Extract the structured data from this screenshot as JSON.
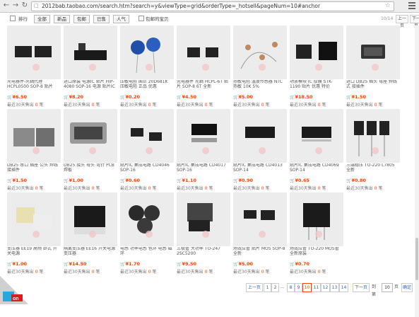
{
  "browser": {
    "url": "2012bab.taobao.com/search.htm?search=y&viewType=grid&orderType=_hotsell&pageNum=10#anchor",
    "star_glyph": "☆"
  },
  "toolbar": {
    "sort_label": "排行",
    "filter_items": [
      "全部",
      "新品",
      "包邮",
      "已售",
      "人气"
    ],
    "free_ship_label": "包邮的宝贝",
    "page_indicator": "10/14",
    "prev_label": "上一页",
    "next_label": "下一页"
  },
  "products": [
    {
      "title": "光电器件-光耦代理 HCPL0500 SOP-8 贴片",
      "price": "6.50",
      "sold": "0"
    },
    {
      "title": "进口原装 电源IC 贴片 HIP-4080 SOP-16 电源 贴片IC",
      "price": "8.20",
      "sold": "0"
    },
    {
      "title": "压敏电阻 国巨 20D681K 压敏电阻 正品 优惠",
      "price": "0.20",
      "price_marker": "",
      "sold": "0"
    },
    {
      "title": "光电器件 光耦 HCPL-6T 贴片 SOP-8 6T 全新",
      "price": "4.50",
      "sold": "0"
    },
    {
      "title": "热敏电阻 温度传感器 NTC 热敏 10K 5%",
      "price": "5.00",
      "sold": "0"
    },
    {
      "title": "功放模块 IC 厚膜 STK-1190 贴片 优惠 特价",
      "price": "18.50",
      "sold": "0"
    },
    {
      "title": "进口 DB25 插头 母座 焊线式 接插件",
      "price": "1.50",
      "sold": "0"
    },
    {
      "title": "DB25 串口 插座 公头 焊线 接插件",
      "price": "1.50",
      "sold": "0"
    },
    {
      "title": "DB25 接头 母头 弯针 PCB 焊板",
      "price": "1.00",
      "sold": "0"
    },
    {
      "title": "贴片IC 集成电路 CD4046 SOP-16",
      "price": "0.60",
      "sold": "0"
    },
    {
      "title": "贴片IC 集成电路 CD4017 SOP-16",
      "price": "1.10",
      "sold": "0"
    },
    {
      "title": "贴片IC 集成电路 CD4013 SOP-14",
      "price": "0.90",
      "sold": "0"
    },
    {
      "title": "贴片IC 集成电路 CD4069 SOP-14",
      "price": "0.65",
      "sold": "0"
    },
    {
      "title": "三端稳压 TO-220 L7805 全新",
      "price": "0.80",
      "sold": "0"
    },
    {
      "title": "变压器 EE19 高频 卧式 开关电源",
      "price": "1.00",
      "sold": "0"
    },
    {
      "title": "隔离变压器 EE16 开关电源 变压器",
      "price": "14.50",
      "sold": "0"
    },
    {
      "title": "电感 功率电感 色环 电感 磁环",
      "price": "1.70",
      "sold": "0"
    },
    {
      "title": "三极管 大功率 TO-247 2SC5200",
      "price": "9.50",
      "sold": "0"
    },
    {
      "title": "场效应管 贴片 MOS SOP-8 全新",
      "price": "5.00",
      "sold": "0"
    },
    {
      "title": "场效应管 TO-220 MOS管 全新原装",
      "price": "0.70",
      "sold": "0"
    }
  ],
  "labels": {
    "sold_prefix": "最近30天售出",
    "sold_suffix": "笔",
    "currency": "¥",
    "cart": "🛒"
  },
  "pager": {
    "prev": "上一页",
    "pages": [
      "1",
      "2",
      "8",
      "9",
      "10",
      "11",
      "12",
      "13",
      "14"
    ],
    "current": "10",
    "dots": "...",
    "next": "下一页",
    "goto_prefix": "到第",
    "goto_value": "10",
    "goto_suffix": "页",
    "confirm": "确定"
  },
  "colors": {
    "accent": "#ff4400",
    "link": "#3366cc"
  }
}
